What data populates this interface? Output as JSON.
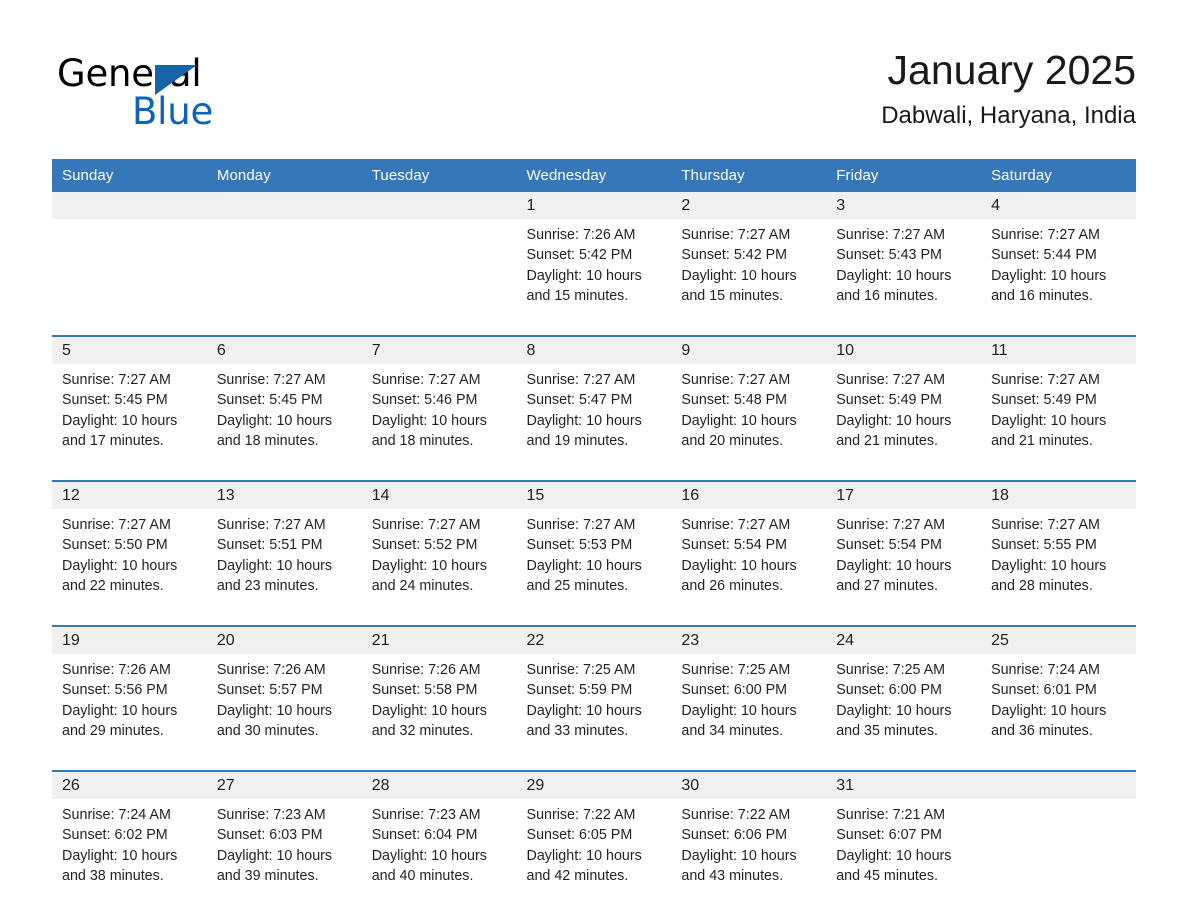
{
  "brand": {
    "name_part1": "General",
    "name_part2": "Blue",
    "triangle_color": "#1565a8",
    "blue_text_color": "#0b63ba"
  },
  "header": {
    "title": "January 2025",
    "location": "Dabwali, Haryana, India"
  },
  "theme": {
    "header_blue": "#3577b8",
    "day_band_gray": "#f0f0f0",
    "text_color": "#231f20"
  },
  "weekdays": [
    "Sunday",
    "Monday",
    "Tuesday",
    "Wednesday",
    "Thursday",
    "Friday",
    "Saturday"
  ],
  "weeks": [
    [
      {
        "day": "",
        "sunrise": "",
        "sunset": "",
        "daylight_line1": "",
        "daylight_line2": ""
      },
      {
        "day": "",
        "sunrise": "",
        "sunset": "",
        "daylight_line1": "",
        "daylight_line2": ""
      },
      {
        "day": "",
        "sunrise": "",
        "sunset": "",
        "daylight_line1": "",
        "daylight_line2": ""
      },
      {
        "day": "1",
        "sunrise": "Sunrise: 7:26 AM",
        "sunset": "Sunset: 5:42 PM",
        "daylight_line1": "Daylight: 10 hours",
        "daylight_line2": "and 15 minutes."
      },
      {
        "day": "2",
        "sunrise": "Sunrise: 7:27 AM",
        "sunset": "Sunset: 5:42 PM",
        "daylight_line1": "Daylight: 10 hours",
        "daylight_line2": "and 15 minutes."
      },
      {
        "day": "3",
        "sunrise": "Sunrise: 7:27 AM",
        "sunset": "Sunset: 5:43 PM",
        "daylight_line1": "Daylight: 10 hours",
        "daylight_line2": "and 16 minutes."
      },
      {
        "day": "4",
        "sunrise": "Sunrise: 7:27 AM",
        "sunset": "Sunset: 5:44 PM",
        "daylight_line1": "Daylight: 10 hours",
        "daylight_line2": "and 16 minutes."
      }
    ],
    [
      {
        "day": "5",
        "sunrise": "Sunrise: 7:27 AM",
        "sunset": "Sunset: 5:45 PM",
        "daylight_line1": "Daylight: 10 hours",
        "daylight_line2": "and 17 minutes."
      },
      {
        "day": "6",
        "sunrise": "Sunrise: 7:27 AM",
        "sunset": "Sunset: 5:45 PM",
        "daylight_line1": "Daylight: 10 hours",
        "daylight_line2": "and 18 minutes."
      },
      {
        "day": "7",
        "sunrise": "Sunrise: 7:27 AM",
        "sunset": "Sunset: 5:46 PM",
        "daylight_line1": "Daylight: 10 hours",
        "daylight_line2": "and 18 minutes."
      },
      {
        "day": "8",
        "sunrise": "Sunrise: 7:27 AM",
        "sunset": "Sunset: 5:47 PM",
        "daylight_line1": "Daylight: 10 hours",
        "daylight_line2": "and 19 minutes."
      },
      {
        "day": "9",
        "sunrise": "Sunrise: 7:27 AM",
        "sunset": "Sunset: 5:48 PM",
        "daylight_line1": "Daylight: 10 hours",
        "daylight_line2": "and 20 minutes."
      },
      {
        "day": "10",
        "sunrise": "Sunrise: 7:27 AM",
        "sunset": "Sunset: 5:49 PM",
        "daylight_line1": "Daylight: 10 hours",
        "daylight_line2": "and 21 minutes."
      },
      {
        "day": "11",
        "sunrise": "Sunrise: 7:27 AM",
        "sunset": "Sunset: 5:49 PM",
        "daylight_line1": "Daylight: 10 hours",
        "daylight_line2": "and 21 minutes."
      }
    ],
    [
      {
        "day": "12",
        "sunrise": "Sunrise: 7:27 AM",
        "sunset": "Sunset: 5:50 PM",
        "daylight_line1": "Daylight: 10 hours",
        "daylight_line2": "and 22 minutes."
      },
      {
        "day": "13",
        "sunrise": "Sunrise: 7:27 AM",
        "sunset": "Sunset: 5:51 PM",
        "daylight_line1": "Daylight: 10 hours",
        "daylight_line2": "and 23 minutes."
      },
      {
        "day": "14",
        "sunrise": "Sunrise: 7:27 AM",
        "sunset": "Sunset: 5:52 PM",
        "daylight_line1": "Daylight: 10 hours",
        "daylight_line2": "and 24 minutes."
      },
      {
        "day": "15",
        "sunrise": "Sunrise: 7:27 AM",
        "sunset": "Sunset: 5:53 PM",
        "daylight_line1": "Daylight: 10 hours",
        "daylight_line2": "and 25 minutes."
      },
      {
        "day": "16",
        "sunrise": "Sunrise: 7:27 AM",
        "sunset": "Sunset: 5:54 PM",
        "daylight_line1": "Daylight: 10 hours",
        "daylight_line2": "and 26 minutes."
      },
      {
        "day": "17",
        "sunrise": "Sunrise: 7:27 AM",
        "sunset": "Sunset: 5:54 PM",
        "daylight_line1": "Daylight: 10 hours",
        "daylight_line2": "and 27 minutes."
      },
      {
        "day": "18",
        "sunrise": "Sunrise: 7:27 AM",
        "sunset": "Sunset: 5:55 PM",
        "daylight_line1": "Daylight: 10 hours",
        "daylight_line2": "and 28 minutes."
      }
    ],
    [
      {
        "day": "19",
        "sunrise": "Sunrise: 7:26 AM",
        "sunset": "Sunset: 5:56 PM",
        "daylight_line1": "Daylight: 10 hours",
        "daylight_line2": "and 29 minutes."
      },
      {
        "day": "20",
        "sunrise": "Sunrise: 7:26 AM",
        "sunset": "Sunset: 5:57 PM",
        "daylight_line1": "Daylight: 10 hours",
        "daylight_line2": "and 30 minutes."
      },
      {
        "day": "21",
        "sunrise": "Sunrise: 7:26 AM",
        "sunset": "Sunset: 5:58 PM",
        "daylight_line1": "Daylight: 10 hours",
        "daylight_line2": "and 32 minutes."
      },
      {
        "day": "22",
        "sunrise": "Sunrise: 7:25 AM",
        "sunset": "Sunset: 5:59 PM",
        "daylight_line1": "Daylight: 10 hours",
        "daylight_line2": "and 33 minutes."
      },
      {
        "day": "23",
        "sunrise": "Sunrise: 7:25 AM",
        "sunset": "Sunset: 6:00 PM",
        "daylight_line1": "Daylight: 10 hours",
        "daylight_line2": "and 34 minutes."
      },
      {
        "day": "24",
        "sunrise": "Sunrise: 7:25 AM",
        "sunset": "Sunset: 6:00 PM",
        "daylight_line1": "Daylight: 10 hours",
        "daylight_line2": "and 35 minutes."
      },
      {
        "day": "25",
        "sunrise": "Sunrise: 7:24 AM",
        "sunset": "Sunset: 6:01 PM",
        "daylight_line1": "Daylight: 10 hours",
        "daylight_line2": "and 36 minutes."
      }
    ],
    [
      {
        "day": "26",
        "sunrise": "Sunrise: 7:24 AM",
        "sunset": "Sunset: 6:02 PM",
        "daylight_line1": "Daylight: 10 hours",
        "daylight_line2": "and 38 minutes."
      },
      {
        "day": "27",
        "sunrise": "Sunrise: 7:23 AM",
        "sunset": "Sunset: 6:03 PM",
        "daylight_line1": "Daylight: 10 hours",
        "daylight_line2": "and 39 minutes."
      },
      {
        "day": "28",
        "sunrise": "Sunrise: 7:23 AM",
        "sunset": "Sunset: 6:04 PM",
        "daylight_line1": "Daylight: 10 hours",
        "daylight_line2": "and 40 minutes."
      },
      {
        "day": "29",
        "sunrise": "Sunrise: 7:22 AM",
        "sunset": "Sunset: 6:05 PM",
        "daylight_line1": "Daylight: 10 hours",
        "daylight_line2": "and 42 minutes."
      },
      {
        "day": "30",
        "sunrise": "Sunrise: 7:22 AM",
        "sunset": "Sunset: 6:06 PM",
        "daylight_line1": "Daylight: 10 hours",
        "daylight_line2": "and 43 minutes."
      },
      {
        "day": "31",
        "sunrise": "Sunrise: 7:21 AM",
        "sunset": "Sunset: 6:07 PM",
        "daylight_line1": "Daylight: 10 hours",
        "daylight_line2": "and 45 minutes."
      },
      {
        "day": "",
        "sunrise": "",
        "sunset": "",
        "daylight_line1": "",
        "daylight_line2": ""
      }
    ]
  ]
}
